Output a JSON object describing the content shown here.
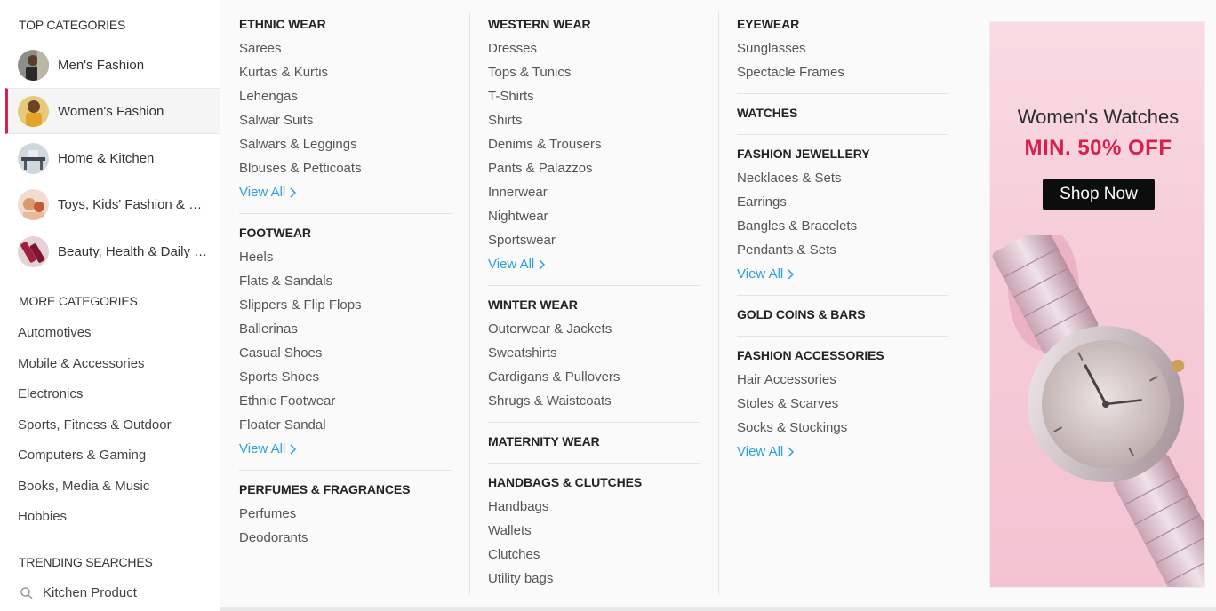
{
  "sidebar": {
    "top_title": "TOP CATEGORIES",
    "top_items": [
      {
        "label": "Men's Fashion",
        "icon": "mens-fashion-thumbnail"
      },
      {
        "label": "Women's Fashion",
        "icon": "womens-fashion-thumbnail"
      },
      {
        "label": "Home & Kitchen",
        "icon": "home-kitchen-thumbnail"
      },
      {
        "label": "Toys, Kids' Fashion & more",
        "icon": "toys-kids-thumbnail"
      },
      {
        "label": "Beauty, Health & Daily Needs",
        "icon": "beauty-health-thumbnail"
      }
    ],
    "more_title": "MORE CATEGORIES",
    "more_items": [
      "Automotives",
      "Mobile & Accessories",
      "Electronics",
      "Sports, Fitness & Outdoor",
      "Computers & Gaming",
      "Books, Media & Music",
      "Hobbies"
    ],
    "trending_title": "TRENDING SEARCHES",
    "trending_items": [
      "Kitchen Product"
    ]
  },
  "menu": {
    "col1": {
      "ethnic": {
        "title": "ETHNIC WEAR",
        "links": [
          "Sarees",
          "Kurtas & Kurtis",
          "Lehengas",
          "Salwar Suits",
          "Salwars & Leggings",
          "Blouses & Petticoats"
        ]
      },
      "footwear": {
        "title": "FOOTWEAR",
        "links": [
          "Heels",
          "Flats & Sandals",
          "Slippers & Flip Flops",
          "Ballerinas",
          "Casual Shoes",
          "Sports Shoes",
          "Ethnic Footwear",
          "Floater Sandal"
        ]
      },
      "perfumes": {
        "title": "PERFUMES & FRAGRANCES",
        "links": [
          "Perfumes",
          "Deodorants"
        ]
      }
    },
    "col2": {
      "western": {
        "title": "WESTERN WEAR",
        "links": [
          "Dresses",
          "Tops & Tunics",
          "T-Shirts",
          "Shirts",
          "Denims & Trousers",
          "Pants & Palazzos",
          "Innerwear",
          "Nightwear",
          "Sportswear"
        ]
      },
      "winter": {
        "title": "WINTER WEAR",
        "links": [
          "Outerwear & Jackets",
          "Sweatshirts",
          "Cardigans & Pullovers",
          "Shrugs & Waistcoats"
        ]
      },
      "maternity": {
        "title": "MATERNITY WEAR"
      },
      "handbags": {
        "title": "HANDBAGS & CLUTCHES",
        "links": [
          "Handbags",
          "Wallets",
          "Clutches",
          "Utility bags"
        ]
      }
    },
    "col3": {
      "eyewear": {
        "title": "EYEWEAR",
        "links": [
          "Sunglasses",
          "Spectacle Frames"
        ]
      },
      "watches": {
        "title": "WATCHES"
      },
      "jewellery": {
        "title": "FASHION JEWELLERY",
        "links": [
          "Necklaces & Sets",
          "Earrings",
          "Bangles & Bracelets",
          "Pendants & Sets"
        ]
      },
      "gold": {
        "title": "GOLD COINS & BARS"
      },
      "accessories": {
        "title": "FASHION ACCESSORIES",
        "links": [
          "Hair Accessories",
          "Stoles & Scarves",
          "Socks & Stockings"
        ]
      }
    },
    "view_all": "View All"
  },
  "banner": {
    "title": "Women's Watches",
    "offer": "MIN. 50% OFF",
    "button": "Shop Now"
  },
  "colors": {
    "accent": "#d6204e",
    "link_blue": "#2e9fdb",
    "banner_bg": "#f6cdd9"
  }
}
